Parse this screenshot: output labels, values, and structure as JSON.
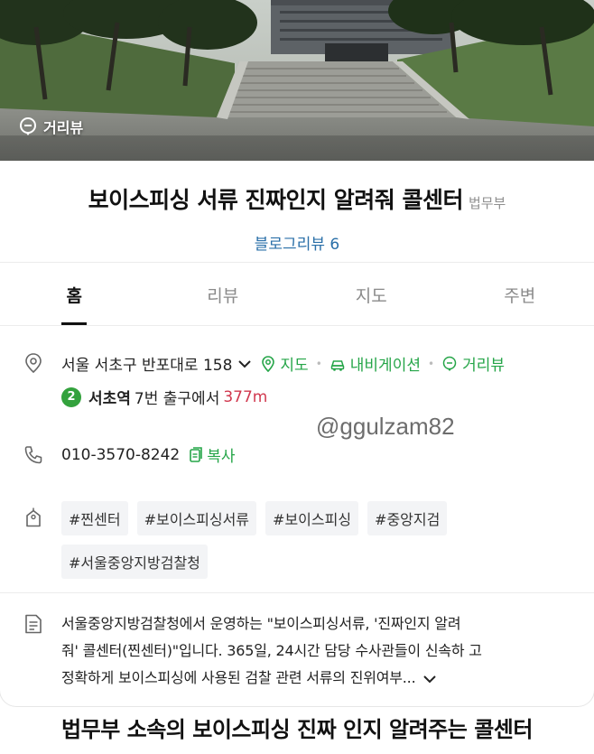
{
  "hero": {
    "streetview_label": "거리뷰"
  },
  "place": {
    "title": "보이스피싱 서류 진짜인지 알려줘 콜센터",
    "category": "법무부",
    "blog_review": "블로그리뷰 6"
  },
  "tabs": [
    {
      "label": "홈",
      "active": true
    },
    {
      "label": "리뷰",
      "active": false
    },
    {
      "label": "지도",
      "active": false
    },
    {
      "label": "주변",
      "active": false
    }
  ],
  "address": {
    "text": "서울 서초구 반포대로 158",
    "map_link": "지도",
    "navi_link": "내비게이션",
    "streetview_link": "거리뷰"
  },
  "subway": {
    "line_number": "2",
    "station": "서초역",
    "exit_text": "7번 출구에서",
    "distance": "377m",
    "line_color": "#33a23d"
  },
  "watermark": "@ggulzam82",
  "phone": {
    "number": "010-3570-8242",
    "copy_label": "복사"
  },
  "tags": [
    "#찐센터",
    "#보이스피싱서류",
    "#보이스피싱",
    "#중앙지검",
    "#서울중앙지방검찰청"
  ],
  "description": {
    "line1": "서울중앙지방검찰청에서 운영하는 \"보이스피싱서류, '진짜인지 알려",
    "line2": "줘' 콜센터(찐센터)\"입니다. 365일, 24시간 담당 수사관들이 신속하 고",
    "line3": "정확하게 보이스피싱에 사용된 검찰 관련 서류의 진위여부..."
  },
  "caption": "법무부 소속의 보이스피싱 진짜 인지 알려주는 콜센터",
  "colors": {
    "accent_green": "#25a548",
    "link_blue": "#2a6fa8",
    "distance_red": "#d1384e"
  }
}
